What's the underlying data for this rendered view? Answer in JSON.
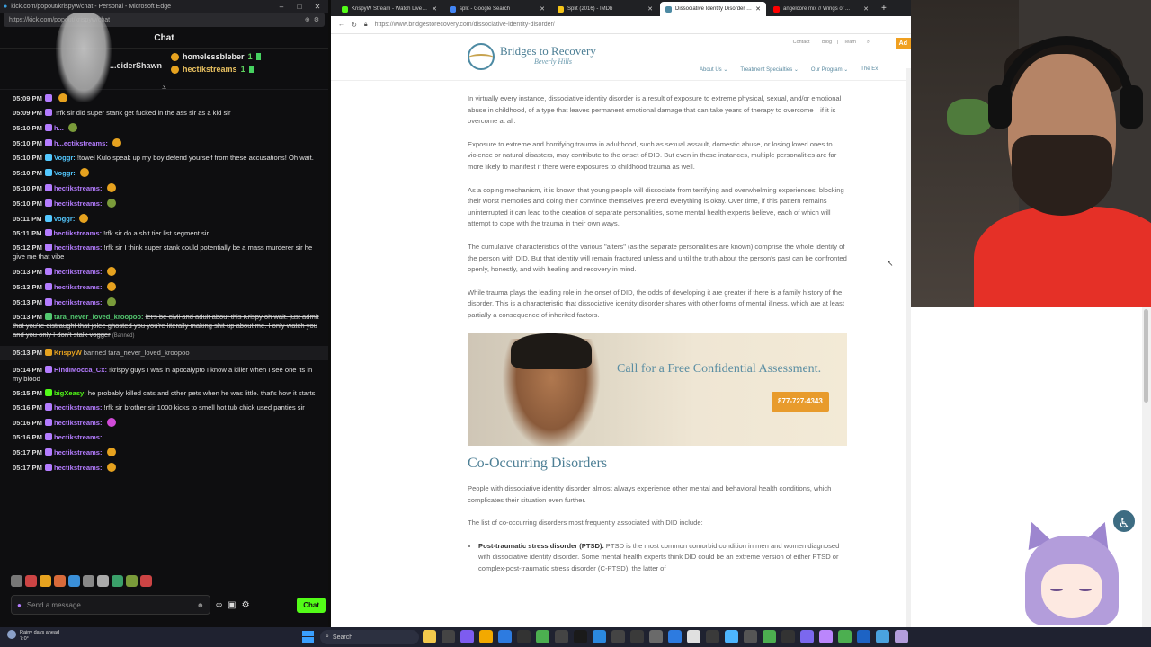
{
  "chat_window": {
    "title": "kick.com/popout/krispyw/chat - Personal - Microsoft Edge",
    "url": "https://kick.com/popout/krispyw/chat",
    "header": "Chat",
    "pinned": [
      {
        "name": "...eiderShawn"
      },
      {
        "name": "homelessbleber",
        "count": "1"
      },
      {
        "name": "hectikstreams",
        "count": "1"
      }
    ],
    "messages": [
      {
        "time": "05:09 PM",
        "user": "",
        "text": "",
        "color": "#b47cff",
        "emote": "#e6a21f"
      },
      {
        "time": "05:09 PM",
        "user": "",
        "text": "!rfk sir did super stank get fucked in the ass sir as a kid sir",
        "color": "#b47cff"
      },
      {
        "time": "05:10 PM",
        "user": "h...",
        "text": "",
        "color": "#b47cff",
        "emote": "#7a9b3a"
      },
      {
        "time": "05:10 PM",
        "user": "h...ectikstreams:",
        "text": "",
        "color": "#b47cff",
        "emote": "#e6a21f"
      },
      {
        "time": "05:10 PM",
        "user": "Voggr:",
        "text": "!towel Kulo speak up my boy defend yourself from these accusations! Oh wait.",
        "color": "#53c8ff"
      },
      {
        "time": "05:10 PM",
        "user": "Voggr:",
        "text": "",
        "color": "#53c8ff",
        "emote": "#e6a21f"
      },
      {
        "time": "05:10 PM",
        "user": "hectikstreams:",
        "text": "",
        "color": "#b47cff",
        "emote": "#e6a21f"
      },
      {
        "time": "05:10 PM",
        "user": "hectikstreams:",
        "text": "",
        "color": "#b47cff",
        "emote": "#7a9b3a"
      },
      {
        "time": "05:11 PM",
        "user": "Voggr:",
        "text": "",
        "color": "#53c8ff",
        "emote": "#e6a21f"
      },
      {
        "time": "05:11 PM",
        "user": "hectikstreams:",
        "text": "!rfk sir do a shit tier list segment sir",
        "color": "#b47cff"
      },
      {
        "time": "05:12 PM",
        "user": "hectikstreams:",
        "text": "!rfk sir I think super stank could potentially be a mass murderer sir he give me that vibe",
        "color": "#b47cff"
      },
      {
        "time": "05:13 PM",
        "user": "hectikstreams:",
        "text": "",
        "color": "#b47cff",
        "emote": "#e6a21f"
      },
      {
        "time": "05:13 PM",
        "user": "hectikstreams:",
        "text": "",
        "color": "#b47cff",
        "emote": "#e6a21f"
      },
      {
        "time": "05:13 PM",
        "user": "hectikstreams:",
        "text": "",
        "color": "#b47cff",
        "emote": "#7a9b3a"
      },
      {
        "time": "05:13 PM",
        "user": "tara_never_loved_kroopoo:",
        "text": "let's be civil and adult about this Krispy oh wait. just admit that you're distraught that jolee ghosted you you're literally making shit up about me. I only watch you and you only I don't stalk vogger",
        "tag": "(Banned)",
        "color": "#53c870",
        "banned": true
      },
      {
        "time": "05:13 PM",
        "user": "KrispyW",
        "text": "banned tara_never_loved_kroopoo",
        "color": "#e6a21f",
        "system": true
      },
      {
        "time": "05:14 PM",
        "user": "HindIMocca_Cx:",
        "text": "!krispy guys I was in apocalypto I know a killer when I see one its in my blood",
        "color": "#b47cff"
      },
      {
        "time": "05:15 PM",
        "user": "bigXeasy:",
        "text": "he probably killed cats and other pets when he was little. that's how it starts",
        "color": "#53fc18"
      },
      {
        "time": "05:16 PM",
        "user": "hectikstreams:",
        "text": "!rfk sir brother sir 1000 kicks to smell hot tub chick used panties sir",
        "color": "#b47cff"
      },
      {
        "time": "05:16 PM",
        "user": "hectikstreams:",
        "text": "",
        "color": "#b47cff",
        "emote": "#d04ad8"
      },
      {
        "time": "05:16 PM",
        "user": "hectikstreams:",
        "text": "",
        "color": "#b47cff"
      },
      {
        "time": "05:17 PM",
        "user": "hectikstreams:",
        "text": "",
        "color": "#b47cff",
        "emote": "#e6a21f"
      },
      {
        "time": "05:17 PM",
        "user": "hectikstreams:",
        "text": "",
        "color": "#b47cff",
        "emote": "#e6a21f"
      }
    ],
    "input_placeholder": "Send a message",
    "send_label": "Chat"
  },
  "browser": {
    "tabs": [
      {
        "title": "KrispyW Stream - Watch Live on K...",
        "color": "#53fc18"
      },
      {
        "title": "split - Google Search",
        "color": "#4285f4"
      },
      {
        "title": "Split (2016) - IMDb",
        "color": "#f5c518"
      },
      {
        "title": "Dissociative Identity Disorder - Br...",
        "color": "#4d8aa3",
        "active": true
      },
      {
        "title": "angelcore mix // Wings of ...",
        "color": "#ff0000"
      }
    ],
    "url": "https://www.bridgestorecovery.com/dissociative-identity-disorder/",
    "site": {
      "logo_name": "Bridges to Recovery",
      "logo_sub": "Beverly Hills",
      "util_links": [
        "Contact",
        "Blog",
        "Team"
      ],
      "admin_label": "Ad",
      "nav": [
        "About Us",
        "Treatment Specialties",
        "Our Program",
        "The Ex"
      ],
      "paragraphs": [
        "In virtually every instance, dissociative identity disorder is a result of exposure to extreme physical, sexual, and/or emotional abuse in childhood, of a type that leaves permanent emotional damage that can take years of therapy to overcome—if it is overcome at all.",
        "Exposure to extreme and horrifying trauma in adulthood, such as sexual assault, domestic abuse, or losing loved ones to violence or natural disasters, may contribute to the onset of DID. But even in these instances, multiple personalities are far more likely to manifest if there were exposures to childhood trauma as well.",
        "As a coping mechanism, it is known that young people will dissociate from terrifying and overwhelming experiences, blocking their worst memories and doing their convince themselves pretend everything is okay. Over time, if this pattern remains uninterrupted it can lead to the creation of separate personalities, some mental health experts believe, each of which will attempt to cope with the trauma in their own ways.",
        "The cumulative characteristics of the various \"alters\" (as the separate personalities are known) comprise the whole identity of the person with DID. But that identity will remain fractured unless and until the truth about the person's past can be confronted openly, honestly, and with healing and recovery in mind.",
        "While trauma plays the leading role in the onset of DID, the odds of developing it are greater if there is a family history of the disorder. This is a characteristic that dissociative identity disorder shares with other forms of mental illness, which are at least partially a consequence of inherited factors."
      ],
      "banner_text": "Call for a Free Confidential Assessment.",
      "banner_phone": "877-727-4343",
      "section_heading": "Co-Occurring Disorders",
      "section_paragraphs": [
        "People with dissociative identity disorder almost always experience other mental and behavioral health conditions, which complicates their situation even further.",
        "The list of co-occurring disorders most frequently associated with DID include:"
      ],
      "list_items": [
        {
          "bold": "Post-traumatic stress disorder (PTSD).",
          "text": " PTSD is the most common comorbid condition in men and women diagnosed with dissociative identity disorder. Some mental health experts think DID could be an extreme version of either PTSD or complex-post-traumatic stress disorder (C-PTSD), the latter of"
        }
      ]
    }
  },
  "taskbar": {
    "weather_line1": "Rainy days ahead",
    "weather_line2": "7:0°",
    "search_label": "Search",
    "icon_colors": [
      "#f2c94c",
      "#444",
      "#7d5cf0",
      "#f2a900",
      "#2d7be0",
      "#333",
      "#4caf50",
      "#444",
      "#1a1a1a",
      "#2b89e0",
      "#444",
      "#3a3a3a",
      "#6a6a6a",
      "#2d7be0",
      "#e0e0e0",
      "#3a3a3a",
      "#4db6ff",
      "#555",
      "#4caf50",
      "#333",
      "#7b68ee",
      "#bb86fc",
      "#4caf50",
      "#1d63c4",
      "#4aa3df",
      "#b39ddb"
    ]
  }
}
